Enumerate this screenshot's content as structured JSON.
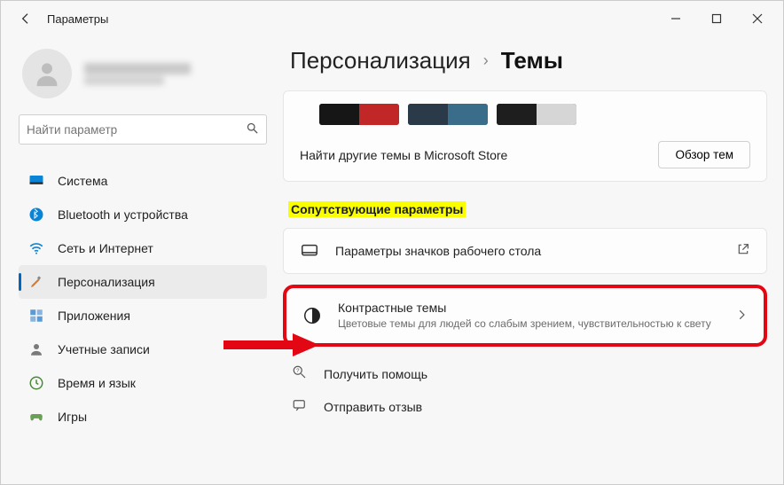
{
  "titlebar": {
    "title": "Параметры"
  },
  "search": {
    "placeholder": "Найти параметр"
  },
  "nav": {
    "items": [
      {
        "label": "Система"
      },
      {
        "label": "Bluetooth и устройства"
      },
      {
        "label": "Сеть и Интернет"
      },
      {
        "label": "Персонализация"
      },
      {
        "label": "Приложения"
      },
      {
        "label": "Учетные записи"
      },
      {
        "label": "Время и язык"
      },
      {
        "label": "Игры"
      }
    ]
  },
  "breadcrumb": {
    "parent": "Персонализация",
    "current": "Темы"
  },
  "store": {
    "text": "Найти другие темы в Microsoft Store",
    "button": "Обзор тем"
  },
  "related": {
    "heading": "Сопутствующие параметры",
    "rows": [
      {
        "title": "Параметры значков рабочего стола"
      },
      {
        "title": "Контрастные темы",
        "sub": "Цветовые темы для людей со слабым зрением, чувствительностью к свету"
      }
    ]
  },
  "links": {
    "help": "Получить помощь",
    "feedback": "Отправить отзыв"
  }
}
